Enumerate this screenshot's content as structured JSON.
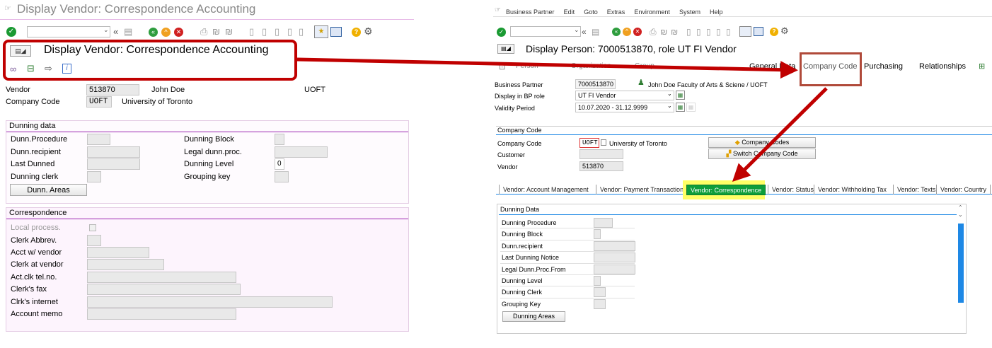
{
  "left": {
    "title": "Display Vendor: Correspondence Accounting",
    "callout_title": "Display Vendor: Correspondence Accounting",
    "header": {
      "vendor_label": "Vendor",
      "vendor_value": "513870",
      "vendor_name": "John Doe",
      "vendor_extra": "UOFT",
      "company_code_label": "Company Code",
      "company_code_value": "UOFT",
      "company_name": "University of Toronto"
    },
    "dunning": {
      "title": "Dunning data",
      "procedure_label": "Dunn.Procedure",
      "recipient_label": "Dunn.recipient",
      "last_dunned_label": "Last Dunned",
      "clerk_label": "Dunning clerk",
      "areas_button": "Dunn. Areas",
      "block_label": "Dunning Block",
      "legal_label": "Legal dunn.proc.",
      "level_label": "Dunning Level",
      "level_value": "0",
      "grouping_label": "Grouping key"
    },
    "correspondence": {
      "title": "Correspondence",
      "local_process_label": "Local process.",
      "clerk_abbrev_label": "Clerk Abbrev.",
      "acct_vendor_label": "Acct w/ vendor",
      "clerk_vendor_label": "Clerk at vendor",
      "tel_label": "Act.clk tel.no.",
      "fax_label": "Clerk's fax",
      "internet_label": "Clrk's internet",
      "memo_label": "Account memo"
    },
    "colors": {
      "callout_border": "#c00000",
      "arrow": "#c00000",
      "group_line": "#9c27b0"
    }
  },
  "right": {
    "menu": [
      "Business Partner",
      "Edit",
      "Goto",
      "Extras",
      "Environment",
      "System",
      "Help"
    ],
    "title": "Display Person: 7000513870, role UT FI Vendor",
    "nav": {
      "person": "Person",
      "organization": "Organization",
      "group": "Group",
      "general_data": "General Data",
      "company_code": "Company Code",
      "purchasing": "Purchasing",
      "relationships": "Relationships"
    },
    "bp": {
      "partner_label": "Business Partner",
      "partner_value": "7000513870",
      "partner_name": "John Doe Faculty of Arts & Sciene / UOFT",
      "role_label": "Display in BP role",
      "role_value": "UT FI Vendor",
      "validity_label": "Validity Period",
      "validity_value": "10.07.2020 - 31.12.9999"
    },
    "company": {
      "title": "Company Code",
      "code_label": "Company Code",
      "code_value": "UOFT",
      "code_name": "University of Toronto",
      "customer_label": "Customer",
      "vendor_label": "Vendor",
      "vendor_value": "513870",
      "company_codes_button": "Company Codes",
      "switch_button": "Switch Company Code"
    },
    "tabs": [
      "Vendor: Account Management",
      "Vendor: Payment Transactions",
      "Vendor: Correspondence",
      "Vendor: Status",
      "Vendor: Withholding Tax",
      "Vendor: Texts",
      "Vendor: Country"
    ],
    "dunning": {
      "title": "Dunning Data",
      "procedure_label": "Dunning Procedure",
      "block_label": "Dunning Block",
      "recipient_label": "Dunn.recipient",
      "last_notice_label": "Last Dunning Notice",
      "legal_label": "Legal Dunn.Proc.From",
      "level_label": "Dunning Level",
      "clerk_label": "Dunning Clerk",
      "grouping_label": "Grouping Key",
      "areas_button": "Dunning Areas"
    },
    "colors": {
      "active_tab": "#0e9e3a",
      "active_tab_highlight": "#ffff66",
      "group_line": "#1e88e5",
      "scrollbar": "#1e88e5"
    }
  }
}
